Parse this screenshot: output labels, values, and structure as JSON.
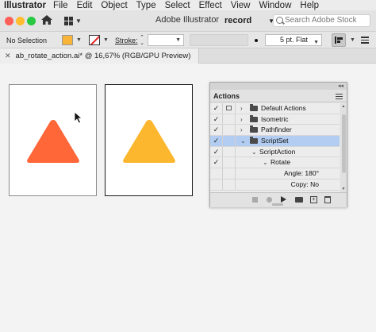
{
  "menubar": {
    "app": "Illustrator",
    "items": [
      "File",
      "Edit",
      "Object",
      "Type",
      "Select",
      "Effect",
      "View",
      "Window",
      "Help"
    ]
  },
  "appbar": {
    "title": "Adobe Illustrator",
    "workspace": "record",
    "search_placeholder": "Search Adobe Stock"
  },
  "controlbar": {
    "selection": "No Selection",
    "stroke_label": "Stroke:",
    "brush": "5 pt. Flat",
    "fill_color": "#f7b438"
  },
  "document": {
    "tab": "ab_rotate_action.ai* @ 16,67% (RGB/GPU Preview)"
  },
  "artboards": [
    {
      "triangle_color": "#ff6638"
    },
    {
      "triangle_color": "#fdb72f"
    }
  ],
  "actions_panel": {
    "title": "Actions",
    "selected_color": "#b2cdf1",
    "rows": [
      {
        "label": "Default Actions",
        "check": "✓",
        "dialog": true,
        "expander": "›",
        "folder": true,
        "indent": 0
      },
      {
        "label": "Isometric",
        "check": "✓",
        "dialog": false,
        "expander": "›",
        "folder": true,
        "indent": 0
      },
      {
        "label": "Pathfinder",
        "check": "✓",
        "dialog": false,
        "expander": "›",
        "folder": true,
        "indent": 0
      },
      {
        "label": "ScriptSet",
        "check": "✓",
        "dialog": false,
        "expander": "⌄",
        "folder": true,
        "indent": 0,
        "selected": true
      },
      {
        "label": "ScriptAction",
        "check": "✓",
        "dialog": false,
        "expander": "⌄",
        "folder": false,
        "indent": 1
      },
      {
        "label": "Rotate",
        "check": "✓",
        "dialog": false,
        "expander": "⌄",
        "folder": false,
        "indent": 2
      },
      {
        "label": "Angle: 180°",
        "check": "",
        "dialog": false,
        "expander": "",
        "folder": false,
        "indent": 3
      },
      {
        "label": "Copy: No",
        "check": "",
        "dialog": false,
        "expander": "",
        "folder": false,
        "indent": 3
      }
    ]
  }
}
